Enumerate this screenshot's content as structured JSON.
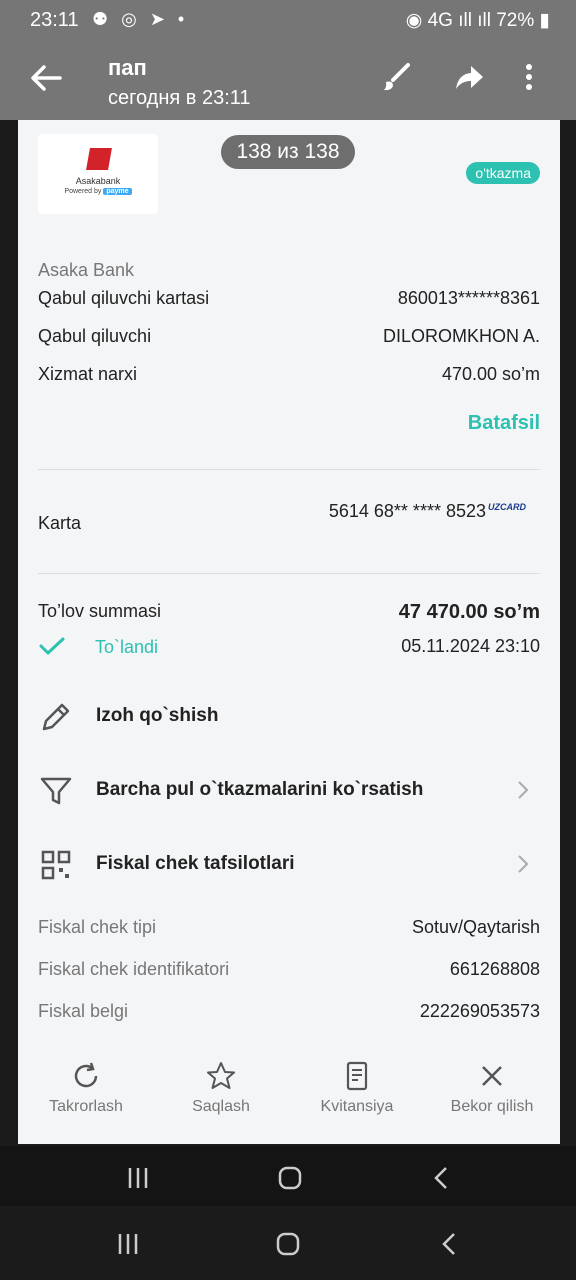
{
  "status_bar": {
    "time": "23:11",
    "left_icons": "⚉ ◎ ➤ •",
    "right_icons": "◉ 4G ıll ıll 72% ▮"
  },
  "header": {
    "title": "пап",
    "subtitle": "сегодня в 23:11"
  },
  "viewer": {
    "counter": "138 из 138"
  },
  "receipt": {
    "logo": {
      "bank": "Asakabank",
      "powered": "Powered by",
      "brand": "payme"
    },
    "type_badge": "o'tkazma",
    "bank_name": "Asaka Bank",
    "fields": [
      {
        "label": "Qabul qiluvchi kartasi",
        "value": "860013******8361"
      },
      {
        "label": "Qabul qiluvchi",
        "value": "DILOROMKHON A."
      },
      {
        "label": "Xizmat narxi",
        "value": "470.00 so’m"
      }
    ],
    "details_link": "Batafsil",
    "card": {
      "label": "Karta",
      "number": "5614 68** **** 8523",
      "network": "UZCARD"
    },
    "payment": {
      "label": "To’lov summasi",
      "amount": "47 470.00 so’m",
      "status": "To`landi",
      "datetime": "05.11.2024 23:10"
    },
    "actions": [
      {
        "label": "Izoh qo`shish",
        "icon": "pencil-icon"
      },
      {
        "label": "Barcha pul o`tkazmalarini ko`rsatish",
        "icon": "filter-icon"
      },
      {
        "label": "Fiskal chek tafsilotlari",
        "icon": "qr-icon"
      }
    ],
    "fiscal": [
      {
        "label": "Fiskal chek tipi",
        "value": "Sotuv/Qaytarish"
      },
      {
        "label": "Fiskal chek identifikatori",
        "value": "661268808"
      },
      {
        "label": "Fiskal belgi",
        "value": "222269053573"
      }
    ],
    "bottom_actions": [
      {
        "label": "Takrorlash",
        "icon": "refresh-icon"
      },
      {
        "label": "Saqlash",
        "icon": "star-icon"
      },
      {
        "label": "Kvitansiya",
        "icon": "document-icon"
      },
      {
        "label": "Bekor qilish",
        "icon": "close-icon"
      }
    ]
  },
  "colors": {
    "accent": "#2cc1b0",
    "header": "#767676",
    "background": "#f4f5f7"
  }
}
